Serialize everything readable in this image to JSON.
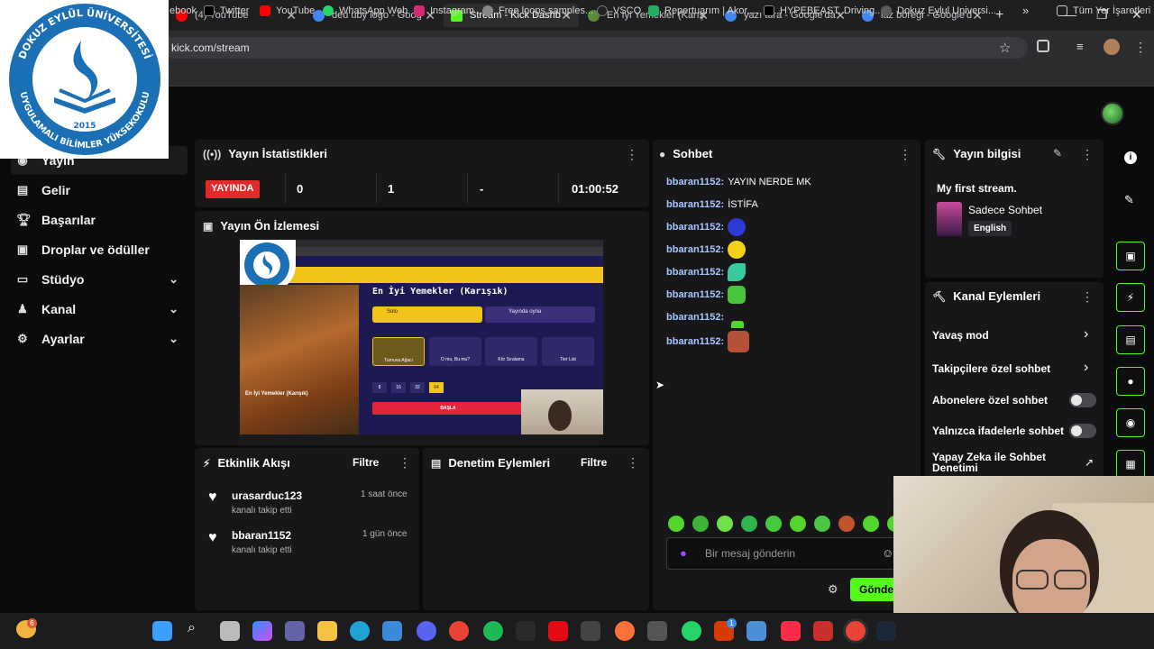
{
  "browser": {
    "tabs": [
      {
        "title": "(4) YouTube",
        "color": "#ff0000",
        "active": false
      },
      {
        "title": "deu uby logo - Goog",
        "color": "#4285f4",
        "active": false
      },
      {
        "title": "Stream - Kick Dashb",
        "color": "#53fc18",
        "active": true
      },
      {
        "title": "En İyi Yemekler (Karış",
        "color": "#5b8c3a",
        "active": false
      },
      {
        "title": "yazı tura - Google'da",
        "color": "#4285f4",
        "active": false
      },
      {
        "title": "laz böreği - Google'd",
        "color": "#4285f4",
        "active": false
      }
    ],
    "new_tab": "+",
    "url": "kick.com/stream",
    "bookmarks": [
      {
        "label": "ebook",
        "color": "#1877f2"
      },
      {
        "label": "Twitter",
        "color": "#000000"
      },
      {
        "label": "YouTube",
        "color": "#ff0000"
      },
      {
        "label": "WhatsApp Web",
        "color": "#25d366"
      },
      {
        "label": "Instagram",
        "color": "#d62976"
      },
      {
        "label": "Free loops samples...",
        "color": "#888888"
      },
      {
        "label": "VSCO",
        "color": "#222222"
      },
      {
        "label": "Repertuarım | Akor,...",
        "color": "#27ae60"
      },
      {
        "label": "HYPEBEAST. Driving...",
        "color": "#000000"
      },
      {
        "label": "Dokuz Eylul Universi...",
        "color": "#5a5a5a"
      }
    ],
    "bookmarks_more": "»",
    "all_bookmarks": "Tüm Yer İşaretleri"
  },
  "logo": {
    "text_top": "DOKUZ EYLÜL ÜNİVERSİTESİ",
    "text_bottom": "UYGULAMALI BİLİMLER YÜKSEKOKULU",
    "year": "2015"
  },
  "sidebar": {
    "items": [
      {
        "label": "Yayın",
        "icon": "broadcast-icon"
      },
      {
        "label": "Gelir",
        "icon": "revenue-icon"
      },
      {
        "label": "Başarılar",
        "icon": "trophy-icon"
      },
      {
        "label": "Droplar ve ödüller",
        "icon": "gift-icon"
      },
      {
        "label": "Stüdyo",
        "icon": "studio-icon"
      },
      {
        "label": "Kanal",
        "icon": "channel-icon"
      },
      {
        "label": "Ayarlar",
        "icon": "settings-icon"
      }
    ]
  },
  "stats": {
    "title": "Yayın İstatistikleri",
    "live_badge": "YAYINDA",
    "values": [
      "0",
      "1",
      "-",
      "01:00:52"
    ]
  },
  "preview": {
    "title": "Yayın Ön İzlemesi",
    "game_title": "En İyi Yemekler (Karışık)",
    "card_caption": "En İyi Yemekler (Karışık)",
    "solo": "Solo",
    "online": "Yayında oyna",
    "modes": [
      "Turnuva Ağacı",
      "O mu, Bu mu?",
      "Kör Sıralama",
      "Tier List"
    ],
    "counts": [
      "8",
      "16",
      "32",
      "64"
    ],
    "start": "BAŞLA"
  },
  "activity": {
    "title": "Etkinlik Akışı",
    "filter": "Filtre",
    "items": [
      {
        "user": "urasarduc123",
        "action": "kanalı takip etti",
        "time": "1 saat önce"
      },
      {
        "user": "bbaran1152",
        "action": "kanalı takip etti",
        "time": "1 gün önce"
      }
    ]
  },
  "moderation": {
    "title": "Denetim Eylemleri",
    "filter": "Filtre"
  },
  "chat": {
    "title": "Sohbet",
    "messages": [
      {
        "user": "bbaran1152:",
        "text": "YAYIN NERDE MK"
      },
      {
        "user": "bbaran1152:",
        "text": "İSTİFA"
      },
      {
        "user": "bbaran1152:",
        "text": "",
        "emote": "#2d3bd6"
      },
      {
        "user": "bbaran1152:",
        "text": "",
        "emote": "#f3d21a"
      },
      {
        "user": "bbaran1152:",
        "text": "",
        "emote": "#37c9a0"
      },
      {
        "user": "bbaran1152:",
        "text": "",
        "emote": "#46c43a"
      },
      {
        "user": "bbaran1152:",
        "text": "",
        "emote": ""
      },
      {
        "user": "bbaran1152:",
        "text": "",
        "emote": "#b5523a"
      }
    ],
    "placeholder": "Bir mesaj gönderin",
    "send": "Gönde",
    "emote_colors": [
      "#53d62b",
      "#3fb23a",
      "#6ee04a",
      "#2fb54b",
      "#44c93f",
      "#53d62b",
      "#49c745",
      "#c0542a",
      "#53d62b",
      "#53d62b"
    ]
  },
  "stream_info": {
    "title": "Yayın bilgisi",
    "stream_title": "My first stream.",
    "category": "Sadece Sohbet",
    "language": "English"
  },
  "channel_actions": {
    "title": "Kanal Eylemleri",
    "items": [
      {
        "label": "Yavaş mod",
        "kind": "chevron"
      },
      {
        "label": "Takipçilere özel sohbet",
        "kind": "chevron"
      },
      {
        "label": "Abonelere özel sohbet",
        "kind": "toggle"
      },
      {
        "label": "Yalnızca ifadelerle sohbet",
        "kind": "toggle"
      },
      {
        "label": "Yapay Zeka ile Sohbet Denetimi",
        "kind": "external"
      }
    ]
  },
  "taskbar": {
    "badge_weather": "6",
    "badge_office": "1"
  }
}
